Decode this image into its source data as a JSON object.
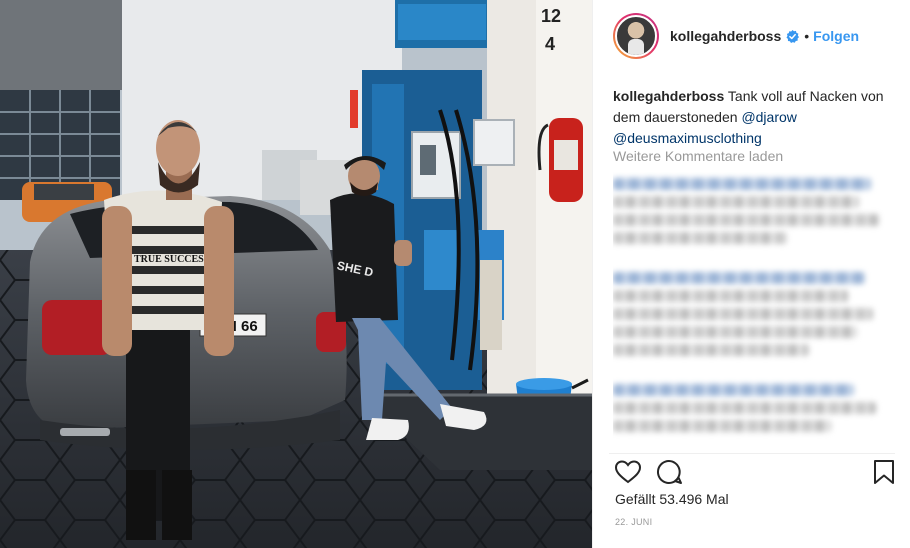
{
  "post": {
    "username": "kollegahderboss",
    "follow_label": "Folgen",
    "separator": "•",
    "caption": {
      "user": "kollegahderboss",
      "text": " Tank voll auf Nacken von dem dauerstoneden ",
      "mention_1": "@djarow",
      "mention_2": "@deusmaximusclothing"
    },
    "load_more_label": "Weitere Kommentare laden",
    "likes_text": "Gefällt 53.496 Mal",
    "date_text": "22. JUNI"
  },
  "photo": {
    "pump_numbers": [
      "12",
      "4"
    ],
    "plate_text": "N 66",
    "shirt_text": "TRUE SUCCESS"
  },
  "icons": {
    "heart": "heart-icon",
    "comment": "comment-bubble-icon",
    "bookmark": "bookmark-icon",
    "verified": "verified-badge-icon"
  },
  "colors": {
    "link": "#3897f0",
    "mention": "#003569",
    "muted": "#999999",
    "text": "#262626"
  }
}
